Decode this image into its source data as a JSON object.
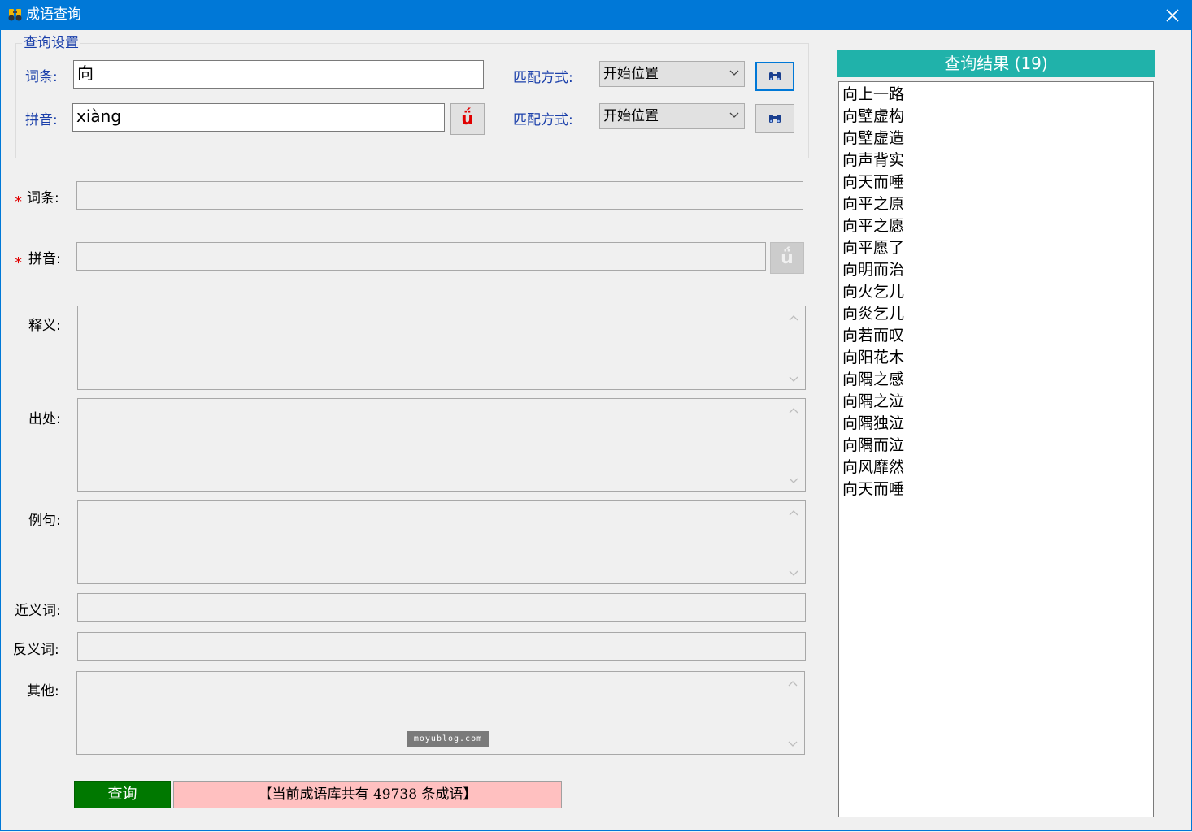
{
  "window": {
    "title": "成语查询",
    "icon": "binoculars-icon",
    "close_glyph": "close-icon"
  },
  "search_settings": {
    "legend": "查询设置",
    "entry_label": "词条:",
    "entry_value": "向",
    "pinyin_label": "拼音:",
    "pinyin_value": "xiàng",
    "tone_button_glyph": "ǘ",
    "match_label_1": "匹配方式:",
    "match_value_1": "开始位置",
    "match_label_2": "匹配方式:",
    "match_value_2": "开始位置",
    "search_icon": "binoculars-icon"
  },
  "detail": {
    "required_mark": "*",
    "entry_label": "词条:",
    "entry_value": "",
    "pinyin_label": "拼音:",
    "pinyin_value": "",
    "tone_button_glyph": "ǘ",
    "meaning_label": "释义:",
    "source_label": "出处:",
    "example_label": "例句:",
    "synonym_label": "近义词:",
    "antonym_label": "反义词:",
    "other_label": "其他:"
  },
  "watermark": "moyublog.com",
  "footer": {
    "query_button": "查询",
    "status_text": "【当前成语库共有 49738 条成语】"
  },
  "results": {
    "header": "查询结果 (19)",
    "items": [
      "向上一路",
      "向壁虚构",
      "向壁虚造",
      "向声背实",
      "向天而唾",
      "向平之原",
      "向平之愿",
      "向平愿了",
      "向明而治",
      "向火乞儿",
      "向炎乞儿",
      "向若而叹",
      "向阳花木",
      "向隅之感",
      "向隅之泣",
      "向隅独泣",
      "向隅而泣",
      "向风靡然",
      "向天而唾"
    ]
  },
  "colors": {
    "titlebar": "#0078d7",
    "label_blue": "#1a3faa",
    "required_red": "#e00000",
    "query_button": "#007800",
    "status_bg": "#ffc0c0",
    "results_header": "#20b2aa"
  }
}
